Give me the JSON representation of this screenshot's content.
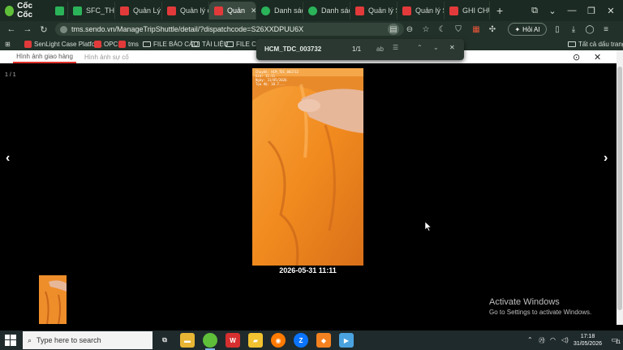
{
  "browser": {
    "brand": "Cốc Cốc",
    "tabs": [
      {
        "label": "",
        "icon": "sheet-icon"
      },
      {
        "label": "SFC_THEO",
        "icon": "sheet-icon"
      },
      {
        "label": "Quản Lý V",
        "icon": "sendo-icon"
      },
      {
        "label": "Quản lý ch",
        "icon": "sendo-icon"
      },
      {
        "label": "Quản",
        "icon": "sendo-icon",
        "active": true
      },
      {
        "label": "Danh sách",
        "icon": "sheets-icon"
      },
      {
        "label": "Danh sách",
        "icon": "sheets-icon"
      },
      {
        "label": "Quản lý Sl",
        "icon": "sendo-icon"
      },
      {
        "label": "Quản lý Sl",
        "icon": "sendo-icon"
      },
      {
        "label": "GHI CHÚ C",
        "icon": "sendo-icon"
      }
    ],
    "url": "tms.sendo.vn/ManageTripShuttle/detail/?dispatchcode=S26XXDPUU6X",
    "ai_button": "Hỏi AI",
    "bookmarks": [
      {
        "label": "SenLight Case Platfor..."
      },
      {
        "label": "OPC"
      },
      {
        "label": "tms"
      },
      {
        "label": "FILE BÁO CÁO"
      },
      {
        "label": "TÀI LIỆU"
      },
      {
        "label": "FILE CÔN"
      }
    ],
    "all_bookmarks": "Tất cả dấu trang"
  },
  "find": {
    "query": "HCM_TDC_003732",
    "count": "1/1",
    "ab": "ab"
  },
  "page": {
    "tabs": [
      "Hình ảnh giao hàng",
      "Hình ảnh sự cố"
    ],
    "counter": "1 / 1",
    "caption": "2026-05-31 11:11",
    "photo_overlay": [
      "Chuyến: HCM_TDC_003732",
      "Giờ: 11:11",
      "Ngày: 31/05/2026",
      "Tọa độ: 10.7..."
    ]
  },
  "watermark": {
    "title": "Activate Windows",
    "subtitle": "Go to Settings to activate Windows."
  },
  "taskbar": {
    "search_placeholder": "Type here to search",
    "time": "17:18",
    "date": "31/05/2026",
    "notif_count": "11"
  }
}
